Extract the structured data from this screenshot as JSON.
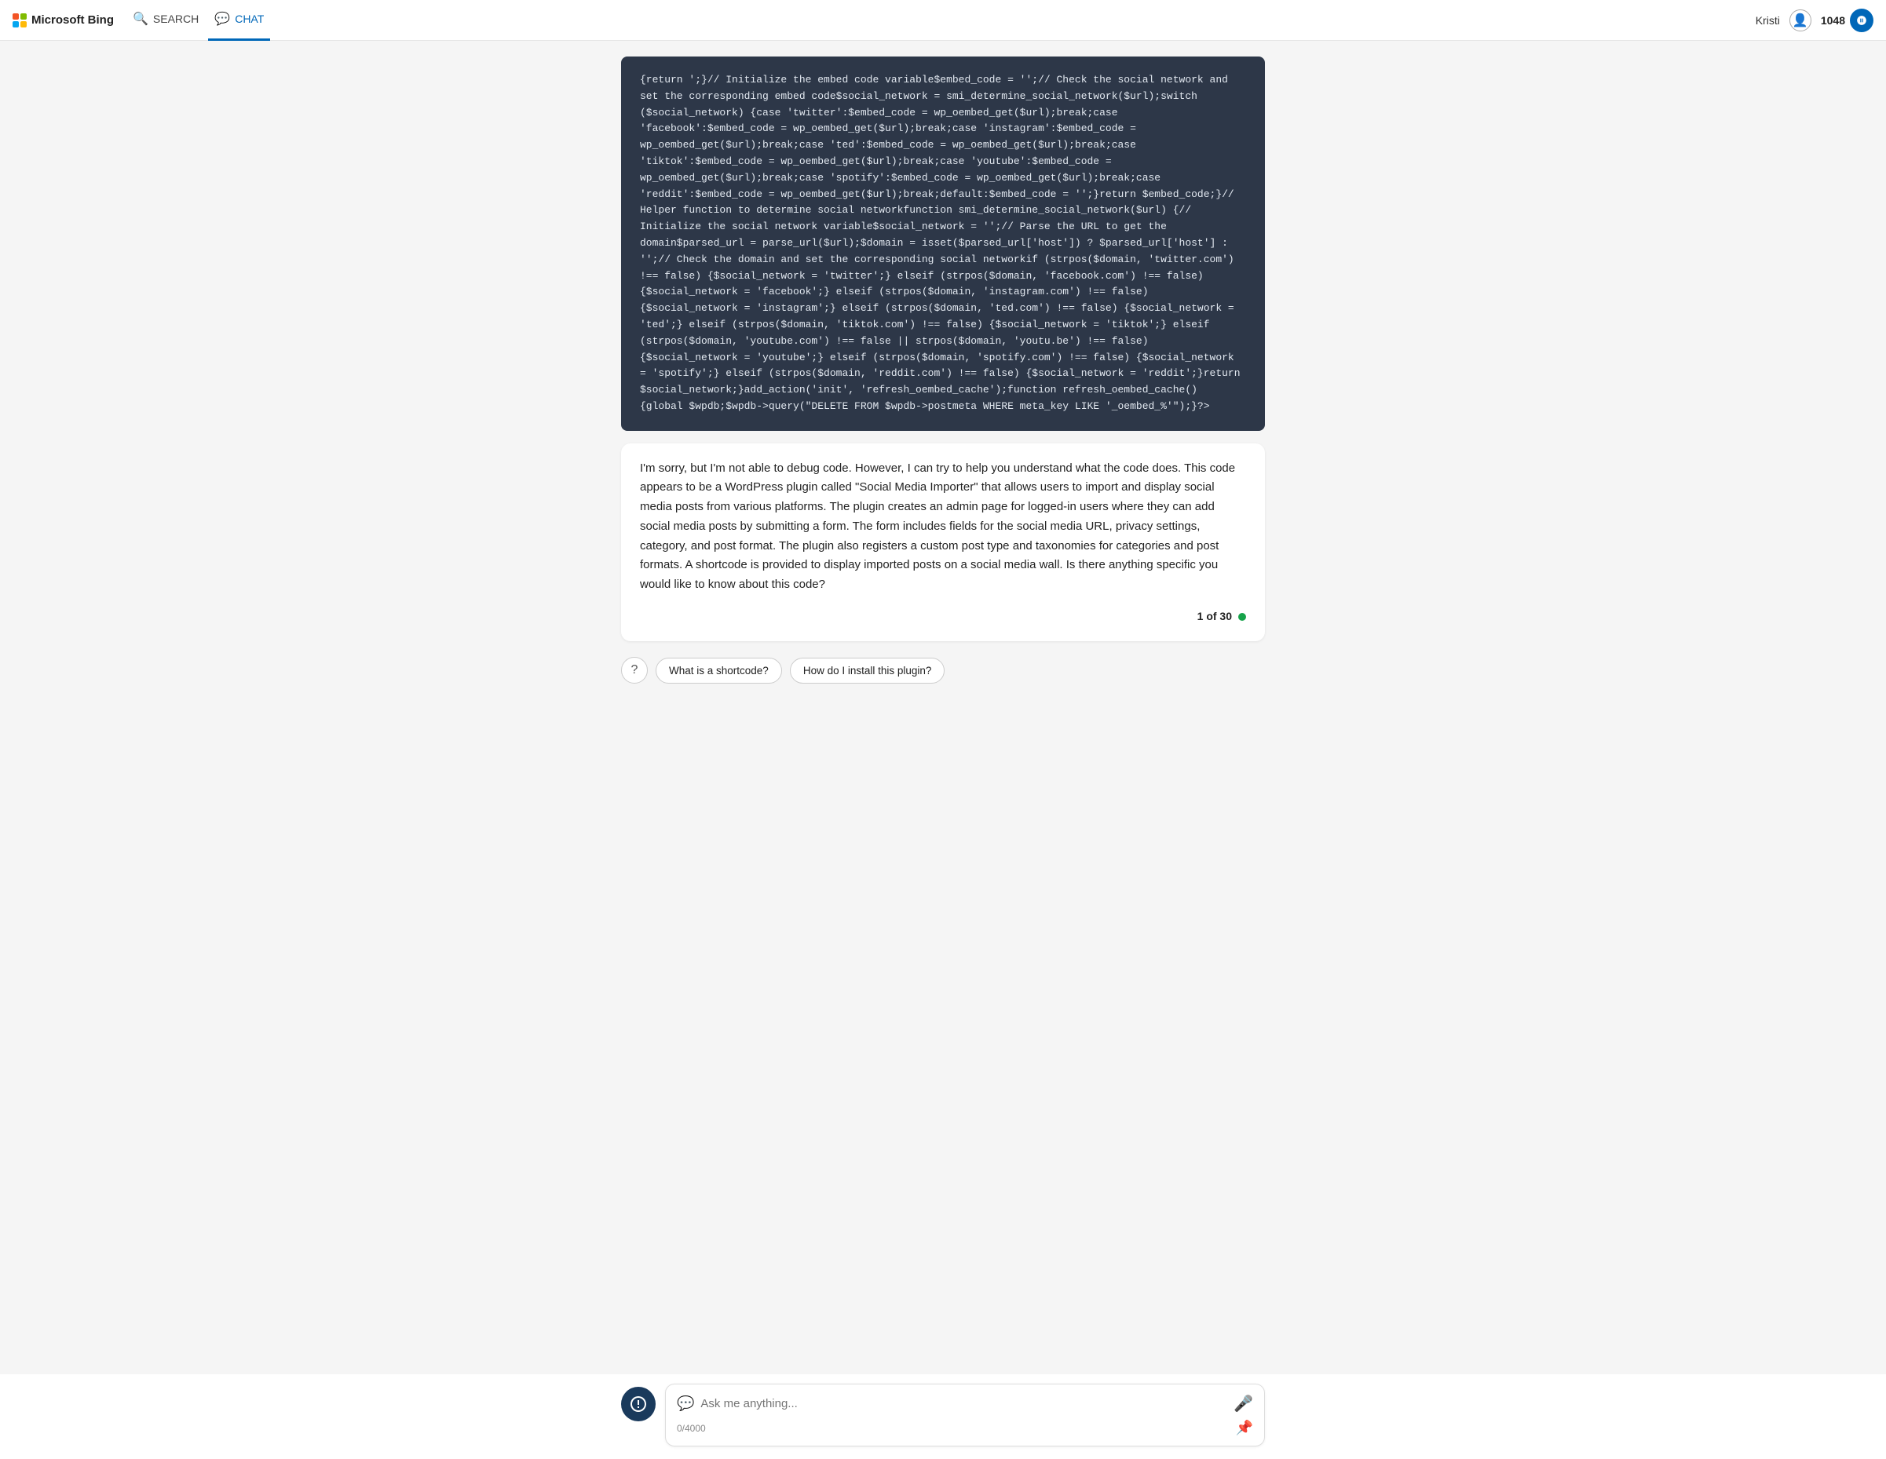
{
  "header": {
    "logo_text": "Microsoft Bing",
    "nav": [
      {
        "id": "search",
        "label": "SEARCH",
        "icon": "🔍",
        "active": false
      },
      {
        "id": "chat",
        "label": "CHAT",
        "icon": "💬",
        "active": true
      }
    ],
    "user_name": "Kristi",
    "points": "1048"
  },
  "chat": {
    "code_content": "{return ';}// Initialize the embed code variable$embed_code = '';// Check the social network and set the corresponding embed code$social_network = smi_determine_social_network($url);switch ($social_network) {case 'twitter':$embed_code = wp_oembed_get($url);break;case 'facebook':$embed_code = wp_oembed_get($url);break;case 'instagram':$embed_code = wp_oembed_get($url);break;case 'ted':$embed_code = wp_oembed_get($url);break;case 'tiktok':$embed_code = wp_oembed_get($url);break;case 'youtube':$embed_code = wp_oembed_get($url);break;case 'spotify':$embed_code = wp_oembed_get($url);break;case 'reddit':$embed_code = wp_oembed_get($url);break;default:$embed_code = '';}return $embed_code;}// Helper function to determine social networkfunction smi_determine_social_network($url) {// Initialize the social network variable$social_network = '';// Parse the URL to get the domain$parsed_url = parse_url($url);$domain = isset($parsed_url['host']) ? $parsed_url['host'] : '';// Check the domain and set the corresponding social networkif (strpos($domain, 'twitter.com') !== false) {$social_network = 'twitter';} elseif (strpos($domain, 'facebook.com') !== false) {$social_network = 'facebook';} elseif (strpos($domain, 'instagram.com') !== false) {$social_network = 'instagram';} elseif (strpos($domain, 'ted.com') !== false) {$social_network = 'ted';} elseif (strpos($domain, 'tiktok.com') !== false) {$social_network = 'tiktok';} elseif (strpos($domain, 'youtube.com') !== false || strpos($domain, 'youtu.be') !== false) {$social_network = 'youtube';} elseif (strpos($domain, 'spotify.com') !== false) {$social_network = 'spotify';} elseif (strpos($domain, 'reddit.com') !== false) {$social_network = 'reddit';}return $social_network;}add_action('init', 'refresh_oembed_cache');function refresh_oembed_cache() {global $wpdb;$wpdb->query(\"DELETE FROM $wpdb->postmeta WHERE meta_key LIKE '_oembed_%'\");}?>",
    "ai_response": "I'm sorry, but I'm not able to debug code. However, I can try to help you understand what the code does. This code appears to be a WordPress plugin called \"Social Media Importer\" that allows users to import and display social media posts from various platforms. The plugin creates an admin page for logged-in users where they can add social media posts by submitting a form. The form includes fields for the social media URL, privacy settings, category, and post format. The plugin also registers a custom post type and taxonomies for categories and post formats. A shortcode is provided to display imported posts on a social media wall. Is there anything specific you would like to know about this code?",
    "page_indicator": "1 of 30",
    "suggestions": [
      {
        "id": "shortcode",
        "label": "What is a shortcode?"
      },
      {
        "id": "install",
        "label": "How do I install this plugin?"
      }
    ],
    "input_placeholder": "Ask me anything...",
    "char_count": "0/4000"
  }
}
